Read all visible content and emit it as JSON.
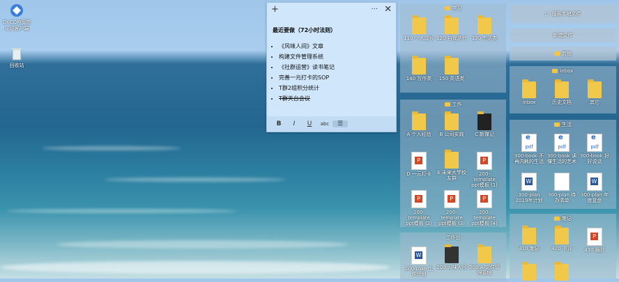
{
  "desktop_icons": [
    {
      "label": "Dr.COM宽带认证客户端",
      "icon": "drcom-icon"
    },
    {
      "label": "回收站",
      "icon": "recycle-bin-icon"
    }
  ],
  "sticky": {
    "title": "最近要做（72小时法则）",
    "items": [
      {
        "text": "《风味人间》文章",
        "done": false
      },
      {
        "text": "构建文件管理系统",
        "done": false
      },
      {
        "text": "《社群运营》读书笔记",
        "done": false
      },
      {
        "text": "完善一元打卡的SOP",
        "done": false
      },
      {
        "text": "T群2组积分统计",
        "done": false
      },
      {
        "text": "T群天台会议",
        "done": true
      }
    ],
    "toolbar": {
      "bold": "B",
      "italic": "I",
      "underline": "U",
      "strike": "abc"
    }
  },
  "fence_study": {
    "title": "学习",
    "items": [
      {
        "label": "110 个人成长",
        "type": "folder"
      },
      {
        "label": "120 自我迭代",
        "type": "folder"
      },
      {
        "label": "130 生活类",
        "type": "folder"
      },
      {
        "label": "140 写作类",
        "type": "folder"
      },
      {
        "label": "150 英语类",
        "type": "folder"
      }
    ]
  },
  "fence_work": {
    "title": "工作",
    "items": [
      {
        "label": "A 个人经验",
        "type": "folder"
      },
      {
        "label": "B 公司实践",
        "type": "folder"
      },
      {
        "label": "C 新媒记",
        "type": "folder"
      },
      {
        "label": "D 一元打卡",
        "type": "ppt"
      },
      {
        "label": "E 未来大学校友群",
        "type": "folder"
      },
      {
        "label": "200-template ppt模板 (1)",
        "type": "ppt"
      },
      {
        "label": "200-template ppt模板 (2)",
        "type": "ppt"
      },
      {
        "label": "200-template ppt模板 (3)",
        "type": "ppt"
      },
      {
        "label": "200-template ppt模板 (4)",
        "type": "ppt"
      }
    ]
  },
  "fence_workspace": {
    "title": "工作台",
    "items": [
      {
        "label": "200-plan 工作计划",
        "type": "word"
      },
      {
        "label": "200 风味人间",
        "type": "folder"
      },
      {
        "label": "200 A 文件管理系统",
        "type": "folder"
      }
    ]
  },
  "right_buttons": {
    "search": "搜索本地文件",
    "new_file": "新建文件",
    "other": "其他"
  },
  "fence_inbox": {
    "title": "inbox",
    "items": [
      {
        "label": "inbox",
        "type": "folder"
      },
      {
        "label": "历史文档",
        "type": "folder"
      },
      {
        "label": "其它",
        "type": "folder"
      }
    ]
  },
  "fence_life": {
    "title": "生活",
    "items": [
      {
        "label": "300-book 不再内耗的生活",
        "type": "pdf"
      },
      {
        "label": "300-book 读懂生活的艺术",
        "type": "pdf"
      },
      {
        "label": "300-book 好好说话",
        "type": "pdf"
      },
      {
        "label": "300-plan 2019年计划",
        "type": "word"
      },
      {
        "label": "300-plan 待办清单",
        "type": "doc"
      },
      {
        "label": "300-plan 年度复盘",
        "type": "word"
      }
    ]
  },
  "fence_notes": {
    "title": "笔记",
    "items": [
      {
        "label": "410 笔记",
        "type": "folder"
      },
      {
        "label": "420 书评",
        "type": "folder"
      },
      {
        "label": "430 摘抄",
        "type": "ppt"
      }
    ]
  }
}
